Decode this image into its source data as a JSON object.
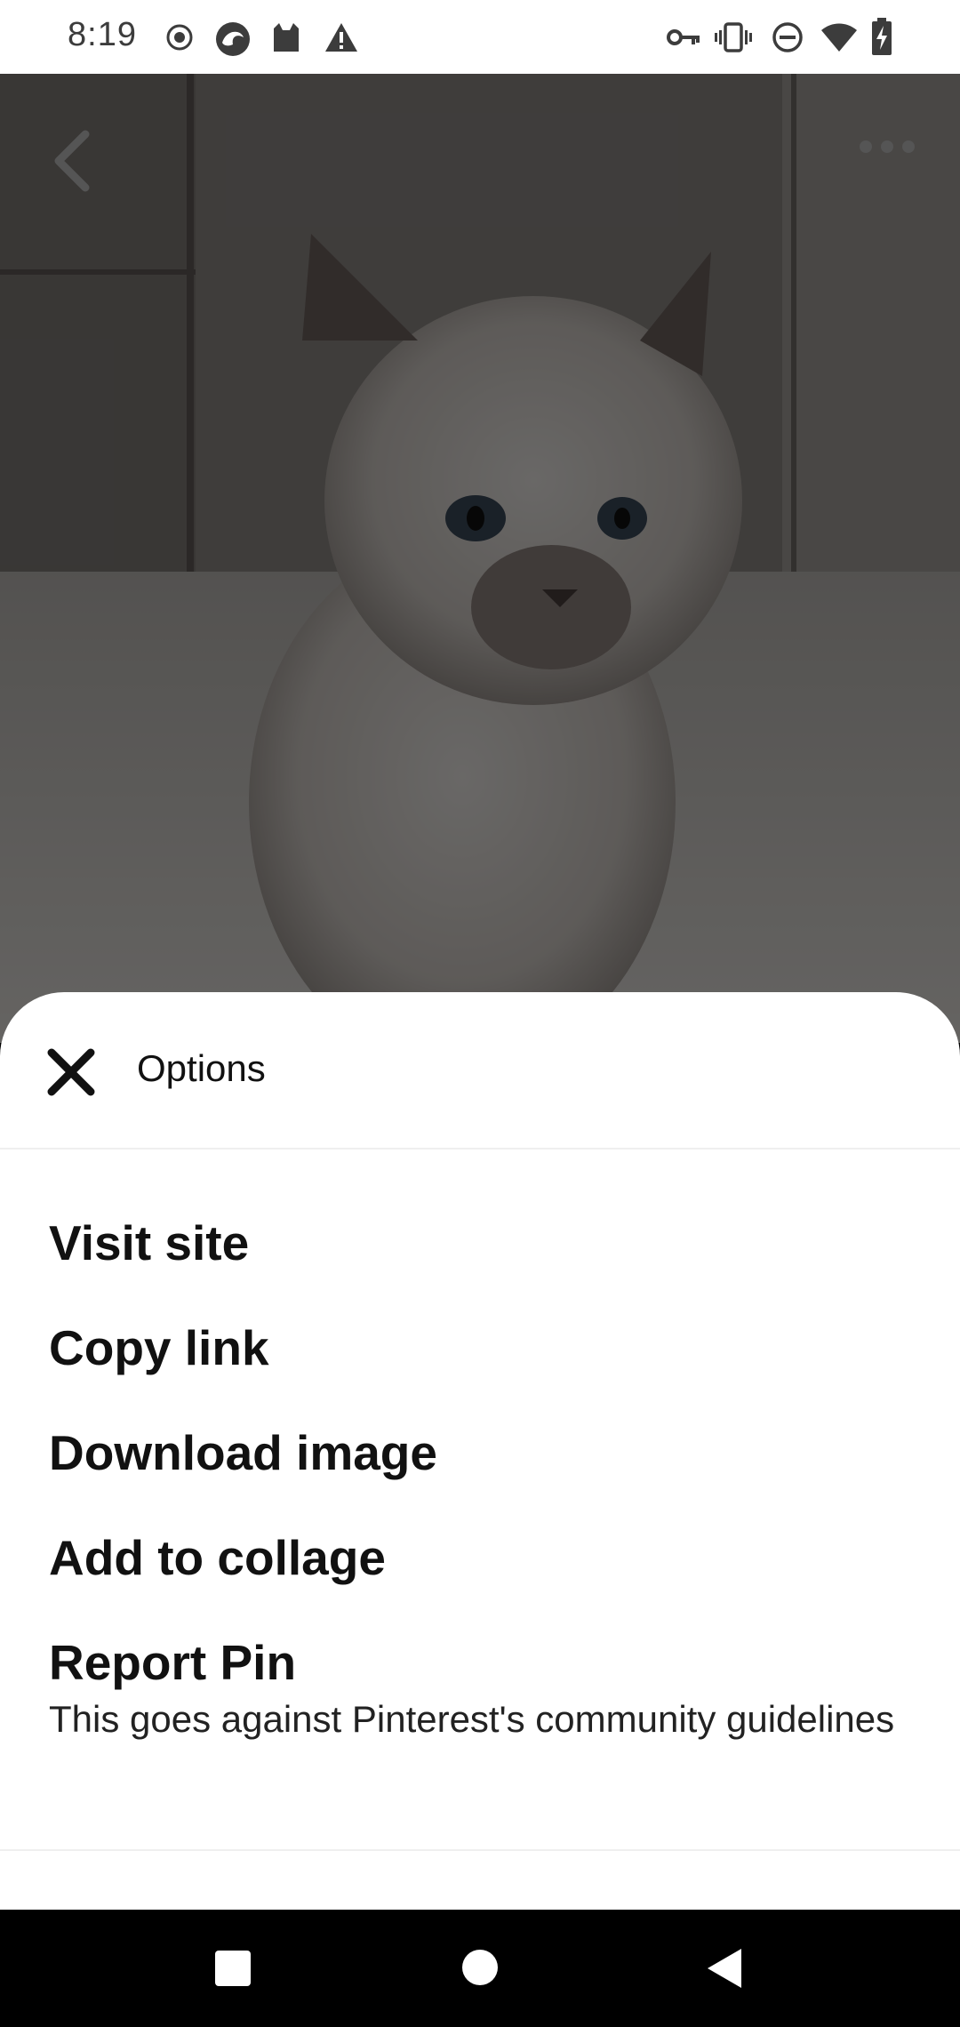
{
  "status_bar": {
    "time": "8:19",
    "left_icons": [
      "record-icon",
      "browser-icon",
      "cat-app-icon",
      "warning-icon"
    ],
    "right_icons": [
      "key-icon",
      "vibrate-icon",
      "do-not-disturb-icon",
      "wifi-icon",
      "battery-charging-icon"
    ]
  },
  "pin": {
    "image": "kitten-photo",
    "back_icon": "chevron-left-icon",
    "more_icon": "more-horizontal-icon"
  },
  "sheet": {
    "title": "Options",
    "close_icon": "close-icon",
    "items": [
      {
        "label": "Visit site"
      },
      {
        "label": "Copy link"
      },
      {
        "label": "Download image"
      },
      {
        "label": "Add to collage"
      },
      {
        "label": "Report Pin",
        "sublabel": "This goes against Pinterest's community guidelines"
      }
    ]
  },
  "nav_bar": {
    "icons": [
      "recents-square-icon",
      "home-circle-icon",
      "back-triangle-icon"
    ]
  },
  "colors": {
    "sheet_bg": "#ffffff",
    "text": "#111111",
    "scrim": "rgba(0,0,0,0.55)"
  }
}
